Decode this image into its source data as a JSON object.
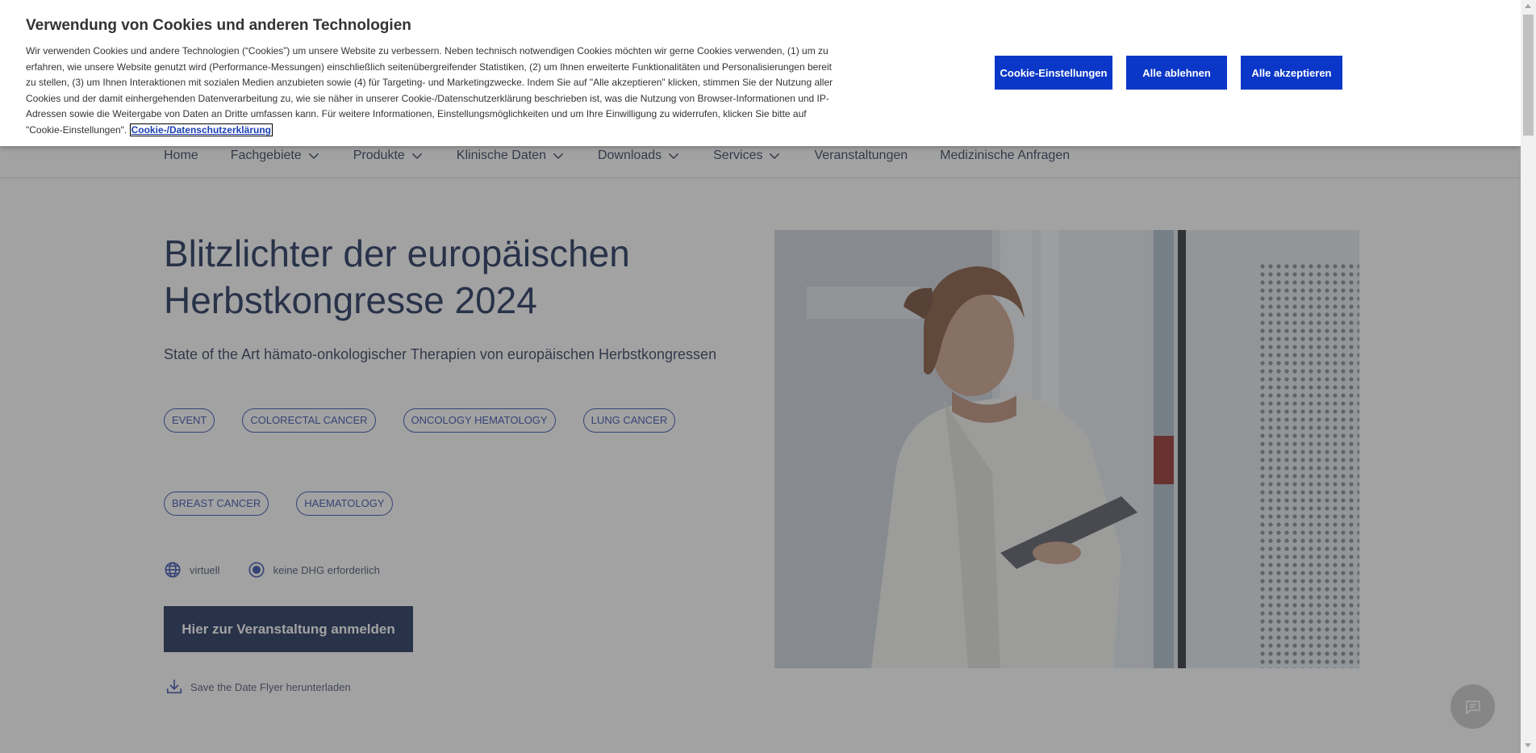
{
  "cookie_banner": {
    "title": "Verwendung von Cookies und anderen Technologien",
    "text": "Wir verwenden Cookies und andere Technologien (“Cookies”) um unsere Website zu verbessern. Neben technisch notwendigen Cookies möchten wir gerne Cookies verwenden, (1) um zu erfahren, wie unsere Website genutzt wird (Performance-Messungen) einschließlich seitenübergreifender Statistiken, (2) um Ihnen erweiterte Funktionalitäten und Personalisierungen bereit zu stellen, (3) um Ihnen Interaktionen mit sozialen Medien anzubieten sowie (4) für Targeting- und Marketingzwecke. Indem Sie auf \"Alle akzeptieren\" klicken, stimmen Sie der Nutzung aller Cookies und der damit einhergehenden Datenverarbeitung zu, wie sie näher in unserer Cookie-/Datenschutzerklärung beschrieben ist, was die Nutzung von Browser-Informationen und IP-Adressen sowie die Weitergabe von Daten an Dritte umfassen kann. Für weitere Informationen, Einstellungsmöglichkeiten und um Ihre Einwilligung zu widerrufen, klicken Sie bitte auf \"Cookie-Einstellungen\".",
    "link_label": "Cookie-/Datenschutzerklärung",
    "buttons": {
      "settings": "Cookie-Einstellungen",
      "reject": "Alle ablehnen",
      "accept": "Alle akzeptieren"
    },
    "button_color": "#0a37c7"
  },
  "nav": {
    "items": [
      {
        "label": "Home",
        "has_dropdown": false
      },
      {
        "label": "Fachgebiete",
        "has_dropdown": true
      },
      {
        "label": "Produkte",
        "has_dropdown": true
      },
      {
        "label": "Klinische Daten",
        "has_dropdown": true
      },
      {
        "label": "Downloads",
        "has_dropdown": true
      },
      {
        "label": "Services",
        "has_dropdown": true
      },
      {
        "label": "Veranstaltungen",
        "has_dropdown": false
      },
      {
        "label": "Medizinische Anfragen",
        "has_dropdown": false
      }
    ]
  },
  "hero": {
    "title": "Blitzlichter der europäischen Herbstkongresse 2024",
    "subtitle": "State of the Art hämato-onkologischer Therapien von europäischen Herbstkongressen",
    "tags_row1": [
      "EVENT",
      "COLORECTAL CANCER",
      "ONCOLOGY HEMATOLOGY",
      "LUNG CANCER"
    ],
    "tags_row2": [
      "BREAST CANCER",
      "HAEMATOLOGY"
    ],
    "meta": {
      "format_label": "virtuell",
      "format_icon": "globe-icon",
      "dhg_label": "keine DHG erforderlich",
      "dhg_icon": "radio-dot-icon"
    },
    "cta_label": "Hier zur Veranstaltung anmelden",
    "download_label": "Save the Date Flyer herunterladen",
    "download_icon": "download-icon",
    "photo_icon": "doctor-with-tablet-photo"
  },
  "chat": {
    "icon": "chat-bubble-icon"
  },
  "colors": {
    "primary_dark": "#0b1e4d",
    "tag_blue": "#2740a6",
    "overlay": "rgba(70,70,70,0.5)"
  }
}
